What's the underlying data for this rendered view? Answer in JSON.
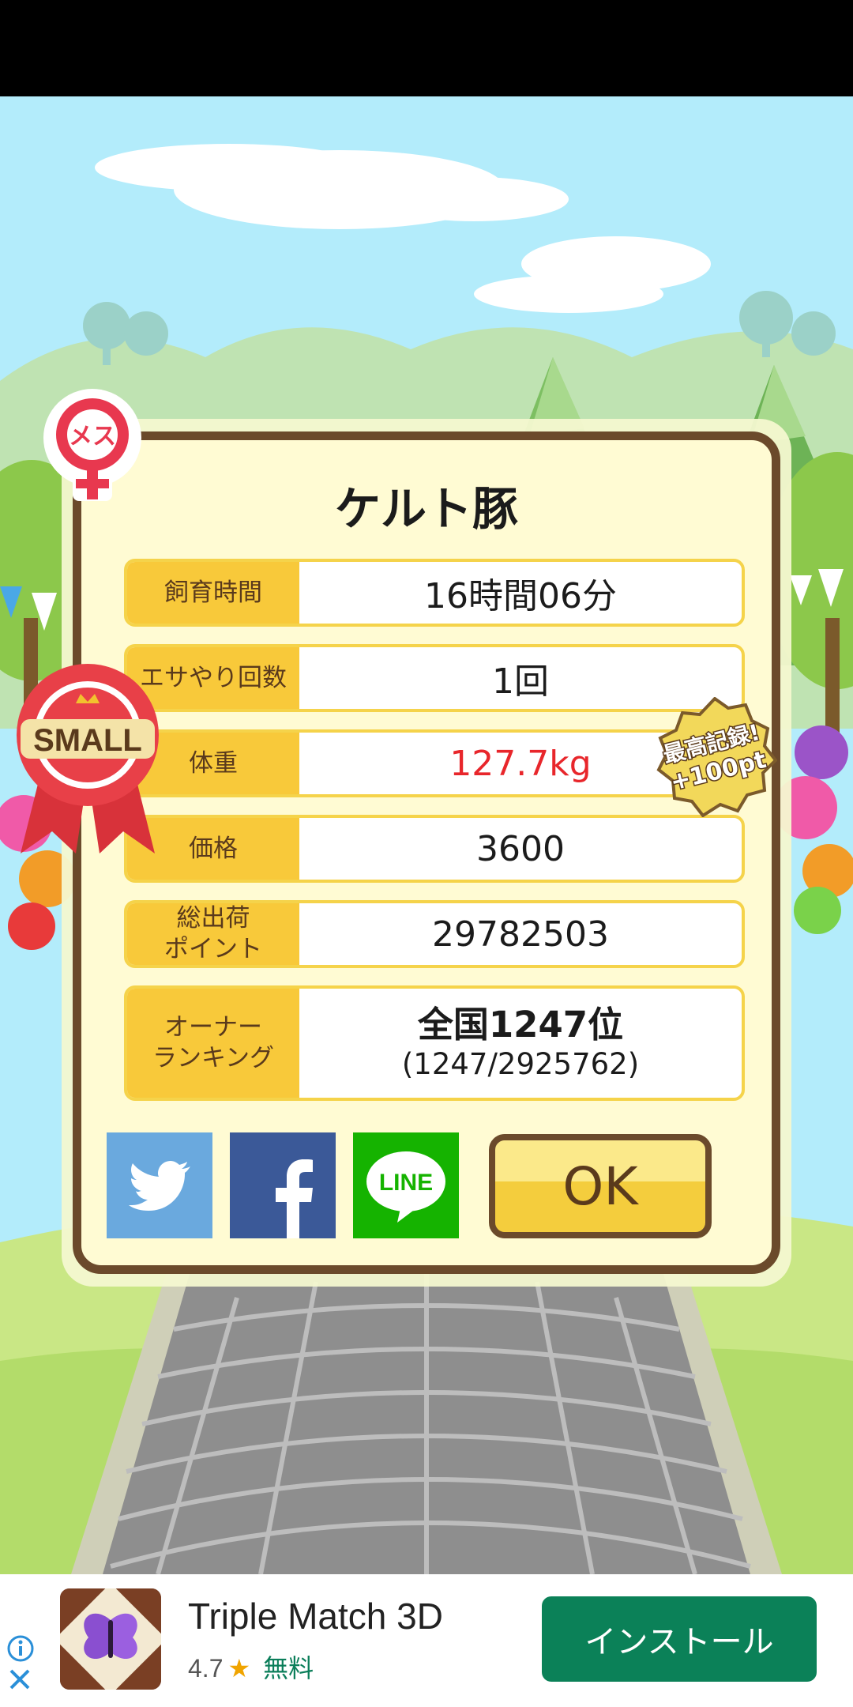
{
  "dialog": {
    "title": "ケルト豚",
    "rows": [
      {
        "label": "飼育時間",
        "value": "16時間06分"
      },
      {
        "label": "エサやり回数",
        "value": "1回"
      },
      {
        "label": "体重",
        "value": "127.7kg"
      },
      {
        "label": "価格",
        "value": "3600"
      },
      {
        "label": "総出荷\nポイント",
        "value": "29782503"
      }
    ],
    "ranking": {
      "label": "オーナー\nランキング",
      "main": "全国1247位",
      "sub": "(1247/2925762)"
    },
    "ok_label": "OK",
    "share": {
      "line_label": "LINE"
    }
  },
  "badges": {
    "gender": "メス",
    "size": "SMALL",
    "record_line1": "最高記録!",
    "record_line2": "+100pt"
  },
  "ad": {
    "title": "Triple Match 3D",
    "rating": "4.7",
    "price": "無料",
    "install_label": "インストール"
  },
  "colors": {
    "weight_value": "#e8262b",
    "twitter": "#6aa9de",
    "facebook": "#3b5998",
    "line": "#15b300",
    "install": "#0b8158"
  }
}
